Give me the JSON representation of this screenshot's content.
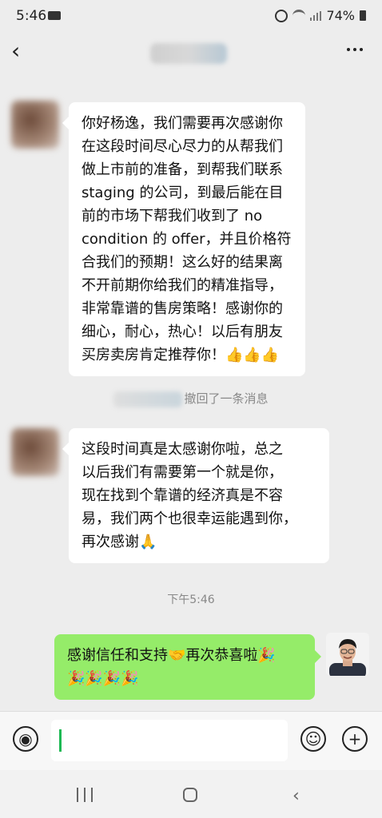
{
  "status_bar": {
    "time": "5:46",
    "battery": "74%"
  },
  "messages": [
    {
      "lines": [
        "你好杨逸，我们需要再次感谢你",
        "在这段时间尽心尽力的从帮我们",
        "做上市前的准备，到帮我们联系",
        "staging 的公司，到最后能在目",
        "前的市场下帮我们收到了 no",
        "condition 的 offer，并且价格符",
        "合我们的预期！这么好的结果离",
        "不开前期你给我们的精准指导，",
        "非常靠谱的售房策略！感谢你的",
        "细心，耐心，热心！以后有朋友",
        "买房卖房肯定推荐你！👍👍👍"
      ]
    },
    {
      "lines": [
        "这段时间真是太感谢你啦，总之",
        "以后我们有需要第一个就是你，",
        "现在找到个靠谱的经济真是不容",
        "易，我们两个也很幸运能遇到你，",
        "再次感谢🙏"
      ]
    }
  ],
  "recall_notice": "撤回了一条消息",
  "timestamp": "下午5:46",
  "my_message": {
    "lines": [
      "感谢信任和支持🤝再次恭喜啦🎉",
      "🎉🎉🎉🎉"
    ]
  },
  "icons": {
    "back": "back-arrow-icon",
    "more": "more-icon",
    "voice": "voice-icon",
    "emoji": "emoji-icon",
    "add": "plus-icon"
  }
}
